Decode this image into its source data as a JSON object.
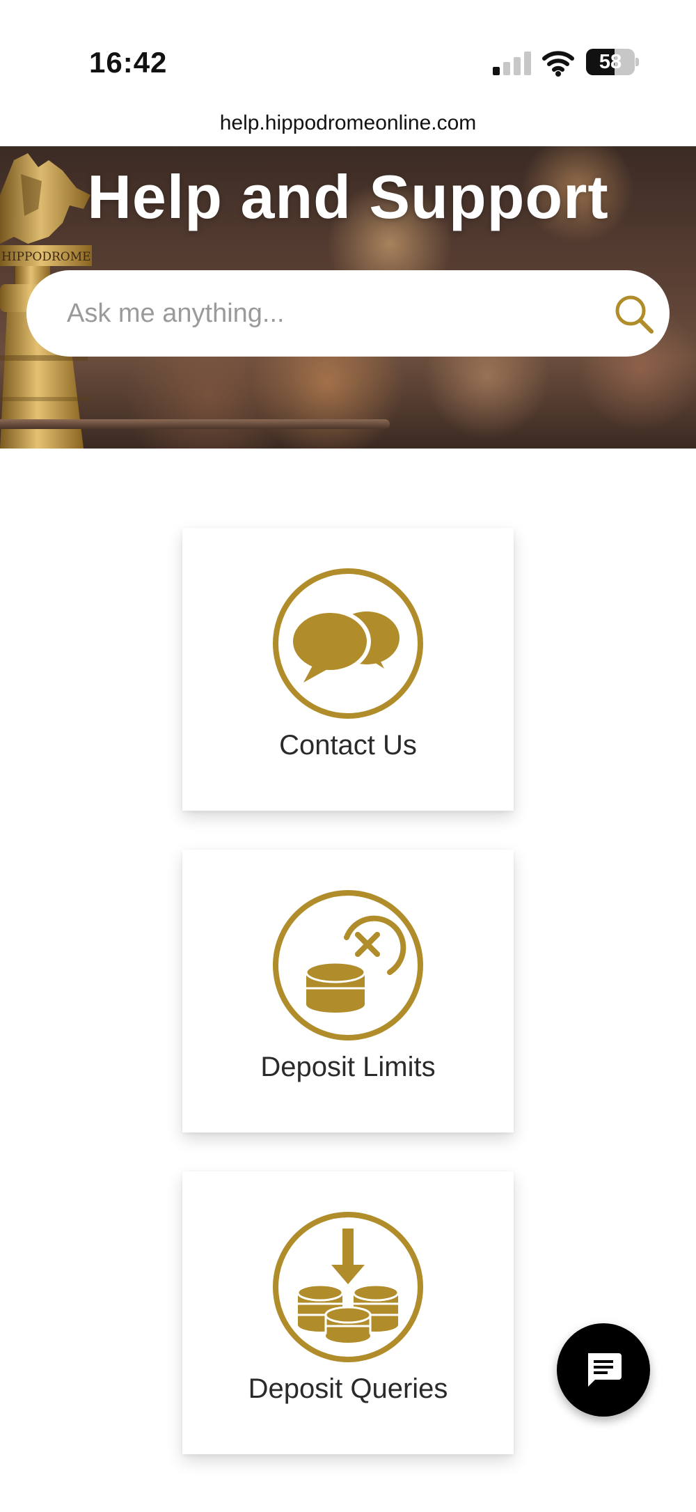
{
  "status_bar": {
    "time": "16:42",
    "battery_level": "58",
    "battery_fraction": 0.58,
    "signal_bars_active": 1,
    "signal_bars_total": 4
  },
  "browser": {
    "url": "help.hippodromeonline.com"
  },
  "hero": {
    "title": "Help and Support",
    "trophy_plaque": "HIPPODROME",
    "search": {
      "placeholder": "Ask me anything..."
    }
  },
  "cards": [
    {
      "label": "Contact Us",
      "icon": "speech-bubbles-icon"
    },
    {
      "label": "Deposit Limits",
      "icon": "coins-limit-icon"
    },
    {
      "label": "Deposit Queries",
      "icon": "coins-deposit-icon"
    }
  ],
  "chat_button": {
    "icon": "chat-icon"
  },
  "colors": {
    "accent_gold": "#B08D2A",
    "text_dark": "#2a2a2a",
    "placeholder_gray": "#9a9a9a",
    "fab_black": "#000000"
  }
}
